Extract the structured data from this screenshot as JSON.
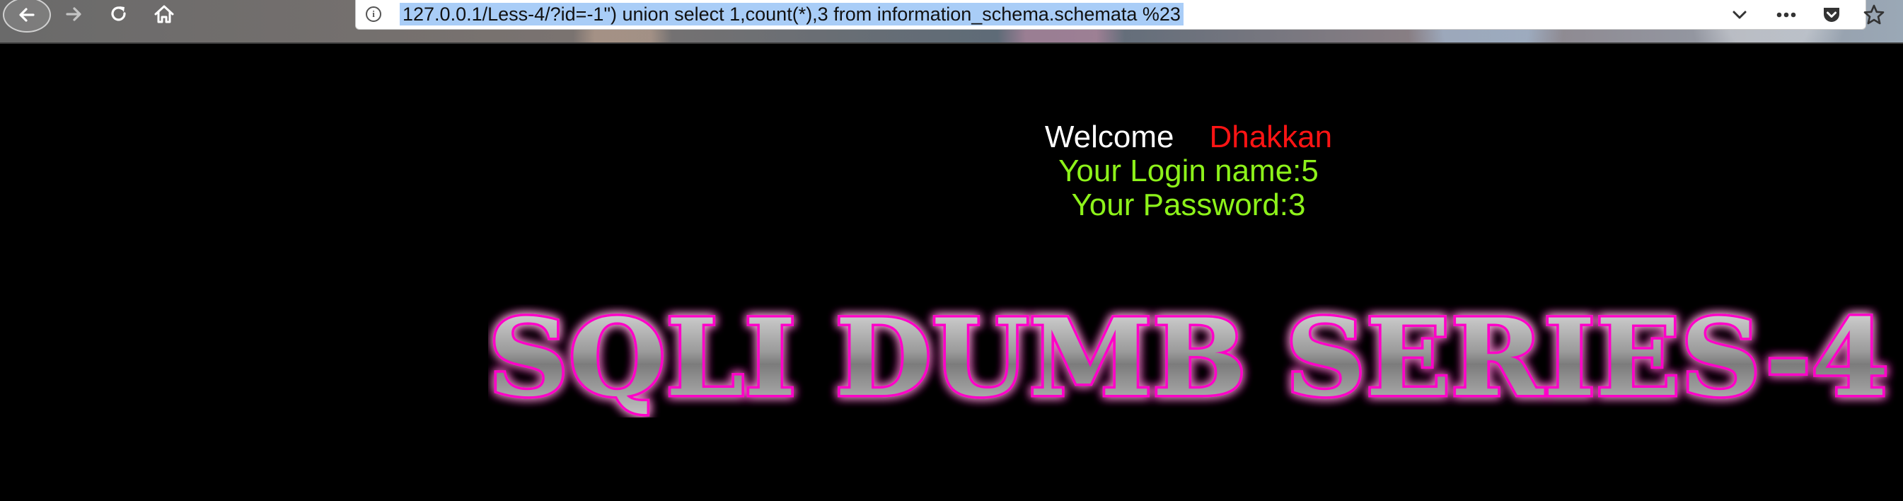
{
  "browser": {
    "url": "127.0.0.1/Less-4/?id=-1\") union select 1,count(*),3 from information_schema.schemata %23"
  },
  "page": {
    "welcome": "Welcome",
    "name": "Dhakkan",
    "login_line": "Your Login name:5",
    "password_line": "Your Password:3",
    "banner": "SQLI DUMB SERIES-4"
  },
  "colors": {
    "background": "#000000",
    "welcome": "#ffffff",
    "name": "#ff1414",
    "result_text": "#8df21a",
    "banner_glow": "#ff00c8",
    "url_highlight": "#a9cdf7"
  }
}
